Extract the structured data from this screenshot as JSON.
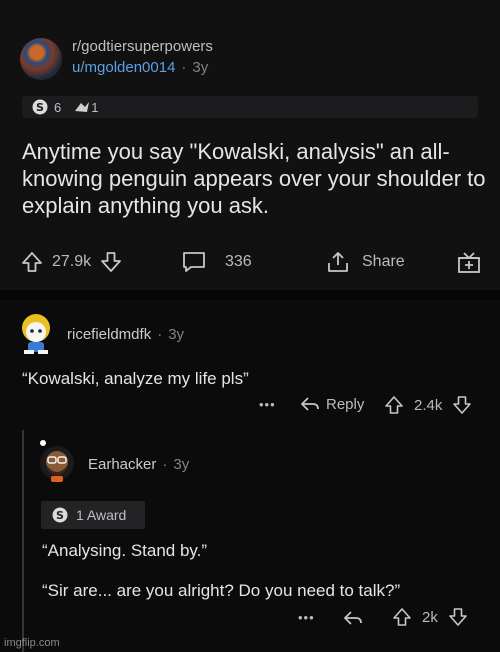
{
  "post": {
    "subreddit": "r/godtiersuperpowers",
    "author": "u/mgolden0014",
    "age": "3y",
    "awards": [
      {
        "icon": "silver-award-icon",
        "count": "6"
      },
      {
        "icon": "wholesome-award-icon",
        "count": "1"
      }
    ],
    "title": "Anytime you say \"Kowalski, analysis\" an all-knowing penguin appears over your shoulder to explain anything you ask.",
    "upvotes": "27.9k",
    "comments": "336",
    "share_label": "Share"
  },
  "comment1": {
    "author": "ricefieldmdfk",
    "age": "3y",
    "text": "“Kowalski, analyze my life pls”",
    "reply_label": "Reply",
    "score": "2.4k"
  },
  "comment2": {
    "author": "Earhacker",
    "age": "3y",
    "award_label": "1 Award",
    "line1": "“Analysing. Stand by.”",
    "line2": "“Sir are... are you alright? Do you need to talk?”",
    "score": "2k"
  },
  "watermark": "imgflip.com"
}
